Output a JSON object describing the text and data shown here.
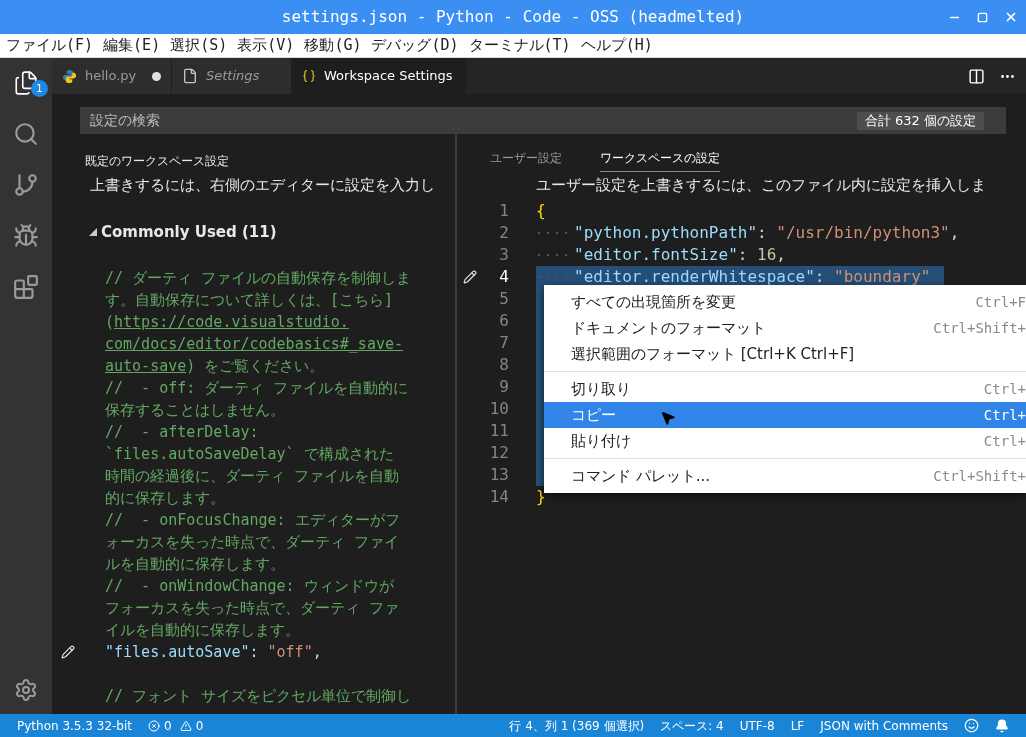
{
  "window": {
    "title": "settings.json - Python - Code - OSS (headmelted)"
  },
  "menu_bar": [
    "ファイル(F)",
    "編集(E)",
    "選択(S)",
    "表示(V)",
    "移動(G)",
    "デバッグ(D)",
    "ターミナル(T)",
    "ヘルプ(H)"
  ],
  "activity_bar": {
    "explorer_badge": "1"
  },
  "tabs": [
    {
      "label": "hello.py",
      "kind": "python",
      "italic": false,
      "dirty": true,
      "selected": false
    },
    {
      "label": "Settings",
      "kind": "file",
      "italic": true,
      "dirty": false,
      "selected": false
    },
    {
      "label": "Workspace Settings",
      "kind": "json",
      "italic": false,
      "dirty": false,
      "selected": true
    }
  ],
  "search": {
    "placeholder": "設定の検索",
    "count": "合計 632 個の設定"
  },
  "default_pane": {
    "header": "既定のワークスペース設定",
    "note": "上書きするには、右側のエディターに設定を入力し",
    "group": {
      "label": "Commonly Used (11)",
      "expanded": true
    },
    "lines": [
      {
        "edited": false,
        "segments": [
          {
            "text": "// ダーティ ファイルの自動保存を制御しま",
            "kind": "comment"
          }
        ]
      },
      {
        "edited": false,
        "segments": [
          {
            "text": "す。自動保存について詳しくは、[こちら]",
            "kind": "comment"
          }
        ]
      },
      {
        "edited": false,
        "segments": [
          {
            "text": "(",
            "kind": "comment"
          },
          {
            "text": "https://code.visualstudio.",
            "kind": "link"
          }
        ]
      },
      {
        "edited": false,
        "segments": [
          {
            "text": "com/docs/editor/codebasics#_save-",
            "kind": "link"
          }
        ]
      },
      {
        "edited": false,
        "segments": [
          {
            "text": "auto-save",
            "kind": "link"
          },
          {
            "text": ") をご覧ください。",
            "kind": "comment"
          }
        ]
      },
      {
        "edited": false,
        "segments": [
          {
            "text": "//  - off: ダーティ ファイルを自動的に",
            "kind": "comment"
          }
        ]
      },
      {
        "edited": false,
        "segments": [
          {
            "text": "保存することはしません。",
            "kind": "comment"
          }
        ]
      },
      {
        "edited": false,
        "segments": [
          {
            "text": "//  - afterDelay:",
            "kind": "comment"
          }
        ]
      },
      {
        "edited": false,
        "segments": [
          {
            "text": "`files.autoSaveDelay` で構成された",
            "kind": "comment"
          }
        ]
      },
      {
        "edited": false,
        "segments": [
          {
            "text": "時間の経過後に、ダーティ ファイルを自動",
            "kind": "comment"
          }
        ]
      },
      {
        "edited": false,
        "segments": [
          {
            "text": "的に保存します。",
            "kind": "comment"
          }
        ]
      },
      {
        "edited": false,
        "segments": [
          {
            "text": "//  - onFocusChange: エディターがフ",
            "kind": "comment"
          }
        ]
      },
      {
        "edited": false,
        "segments": [
          {
            "text": "ォーカスを失った時点で、ダーティ ファイ",
            "kind": "comment"
          }
        ]
      },
      {
        "edited": false,
        "segments": [
          {
            "text": "ルを自動的に保存します。",
            "kind": "comment"
          }
        ]
      },
      {
        "edited": false,
        "segments": [
          {
            "text": "//  - onWindowChange: ウィンドウが",
            "kind": "comment"
          }
        ]
      },
      {
        "edited": false,
        "segments": [
          {
            "text": "フォーカスを失った時点で、ダーティ ファ",
            "kind": "comment"
          }
        ]
      },
      {
        "edited": false,
        "segments": [
          {
            "text": "イルを自動的に保存します。",
            "kind": "comment"
          }
        ]
      },
      {
        "edited": true,
        "segments": [
          {
            "text": "\"files.autoSave\"",
            "kind": "key"
          },
          {
            "text": ":",
            "kind": "punct"
          },
          {
            "text": "\"off\"",
            "kind": "string"
          },
          {
            "text": ",",
            "kind": "punct"
          }
        ]
      },
      {
        "edited": false
      },
      {
        "edited": false,
        "segments": [
          {
            "text": "// フォント サイズをピクセル単位で制御し",
            "kind": "comment"
          }
        ]
      }
    ]
  },
  "user_pane": {
    "tabs": [
      {
        "label": "ユーザー設定",
        "selected": false
      },
      {
        "label": "ワークスペースの設定",
        "selected": true
      }
    ],
    "note": "ユーザー設定を上書きするには、このファイル内に設定を挿入しま",
    "lines": [
      {
        "number": "1",
        "indent": false,
        "edited": false,
        "selected": false,
        "segments": [
          {
            "text": "{",
            "kind": "brace"
          }
        ]
      },
      {
        "number": "2",
        "indent": true,
        "edited": false,
        "selected": false,
        "segments": [
          {
            "text": "\"python.pythonPath\"",
            "kind": "key"
          },
          {
            "text": ":",
            "kind": "punct"
          },
          {
            "text": "\"/usr/bin/python3\"",
            "kind": "string"
          },
          {
            "text": ",",
            "kind": "punct"
          }
        ]
      },
      {
        "number": "3",
        "indent": true,
        "edited": false,
        "selected": false,
        "segments": [
          {
            "text": "\"editor.fontSize\"",
            "kind": "key"
          },
          {
            "text": ":",
            "kind": "punct"
          },
          {
            "text": "16",
            "kind": "number"
          },
          {
            "text": ",",
            "kind": "punct"
          }
        ]
      },
      {
        "number": "4",
        "indent": true,
        "edited": true,
        "selected": true,
        "segments": [
          {
            "text": "\"editor.renderWhitespace\"",
            "kind": "key"
          },
          {
            "text": ":",
            "kind": "punct"
          },
          {
            "text": "\"boundary\"",
            "kind": "string"
          }
        ]
      },
      {
        "number": "5",
        "indent": false,
        "edited": false,
        "selected": true
      },
      {
        "number": "6",
        "indent": false,
        "edited": false,
        "selected": true
      },
      {
        "number": "7",
        "indent": false,
        "edited": false,
        "selected": true
      },
      {
        "number": "8",
        "indent": false,
        "edited": false,
        "selected": true
      },
      {
        "number": "9",
        "indent": false,
        "edited": false,
        "selected": true
      },
      {
        "number": "10",
        "indent": false,
        "edited": false,
        "selected": true
      },
      {
        "number": "11",
        "indent": false,
        "edited": false,
        "selected": true
      },
      {
        "number": "12",
        "indent": false,
        "edited": false,
        "selected": true
      },
      {
        "number": "13",
        "indent": false,
        "edited": false,
        "selected": true
      },
      {
        "number": "14",
        "indent": false,
        "edited": false,
        "selected": false,
        "segments": [
          {
            "text": "}",
            "kind": "brace"
          }
        ]
      }
    ]
  },
  "context_menu": {
    "groups": [
      [
        {
          "label": "すべての出現箇所を変更",
          "shortcut": "Ctrl+F",
          "selected": false
        },
        {
          "label": "ドキュメントのフォーマット",
          "shortcut": "Ctrl+Shift+",
          "selected": false
        },
        {
          "label": "選択範囲のフォーマット [Ctrl+K Ctrl+F]",
          "selected": false
        }
      ],
      [
        {
          "label": "切り取り",
          "shortcut": "Ctrl+",
          "selected": false
        },
        {
          "label": "コピー",
          "shortcut": "Ctrl+",
          "selected": true
        },
        {
          "label": "貼り付け",
          "shortcut": "Ctrl+",
          "selected": false
        }
      ],
      [
        {
          "label": "コマンド パレット...",
          "shortcut": "Ctrl+Shift+",
          "selected": false
        }
      ]
    ]
  },
  "status_bar": {
    "interpreter": "Python 3.5.3 32-bit",
    "errors": "0",
    "warnings": "0",
    "position": "行 4、列 1 (369 個選択)",
    "indentation": "スペース: 4",
    "encoding": "UTF-8",
    "line_ending": "LF",
    "language": "JSON with Comments"
  }
}
